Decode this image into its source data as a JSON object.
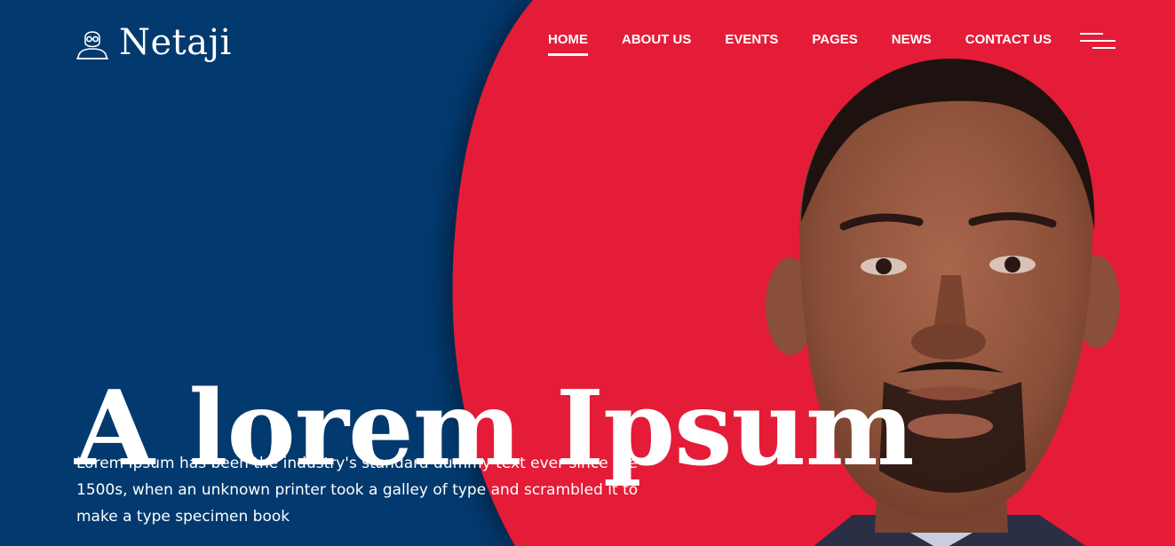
{
  "brand": {
    "name": "Netaji",
    "icon": "user-avatar-icon"
  },
  "nav": {
    "items": [
      {
        "label": "HOME",
        "active": true
      },
      {
        "label": "ABOUT US",
        "active": false
      },
      {
        "label": "EVENTS",
        "active": false
      },
      {
        "label": "PAGES",
        "active": false
      },
      {
        "label": "NEWS",
        "active": false
      },
      {
        "label": "CONTACT US",
        "active": false
      }
    ],
    "menu_icon": "hamburger-menu-icon"
  },
  "hero": {
    "headline": "A lorem Ipsum",
    "description": "Lorem Ipsum has been the industry's standard dummy text ever since the 1500s, when an unknown printer took a galley of type and scrambled it to make a type specimen book"
  },
  "colors": {
    "navy": "#02396e",
    "red": "#e41a38",
    "text": "#ffffff"
  }
}
